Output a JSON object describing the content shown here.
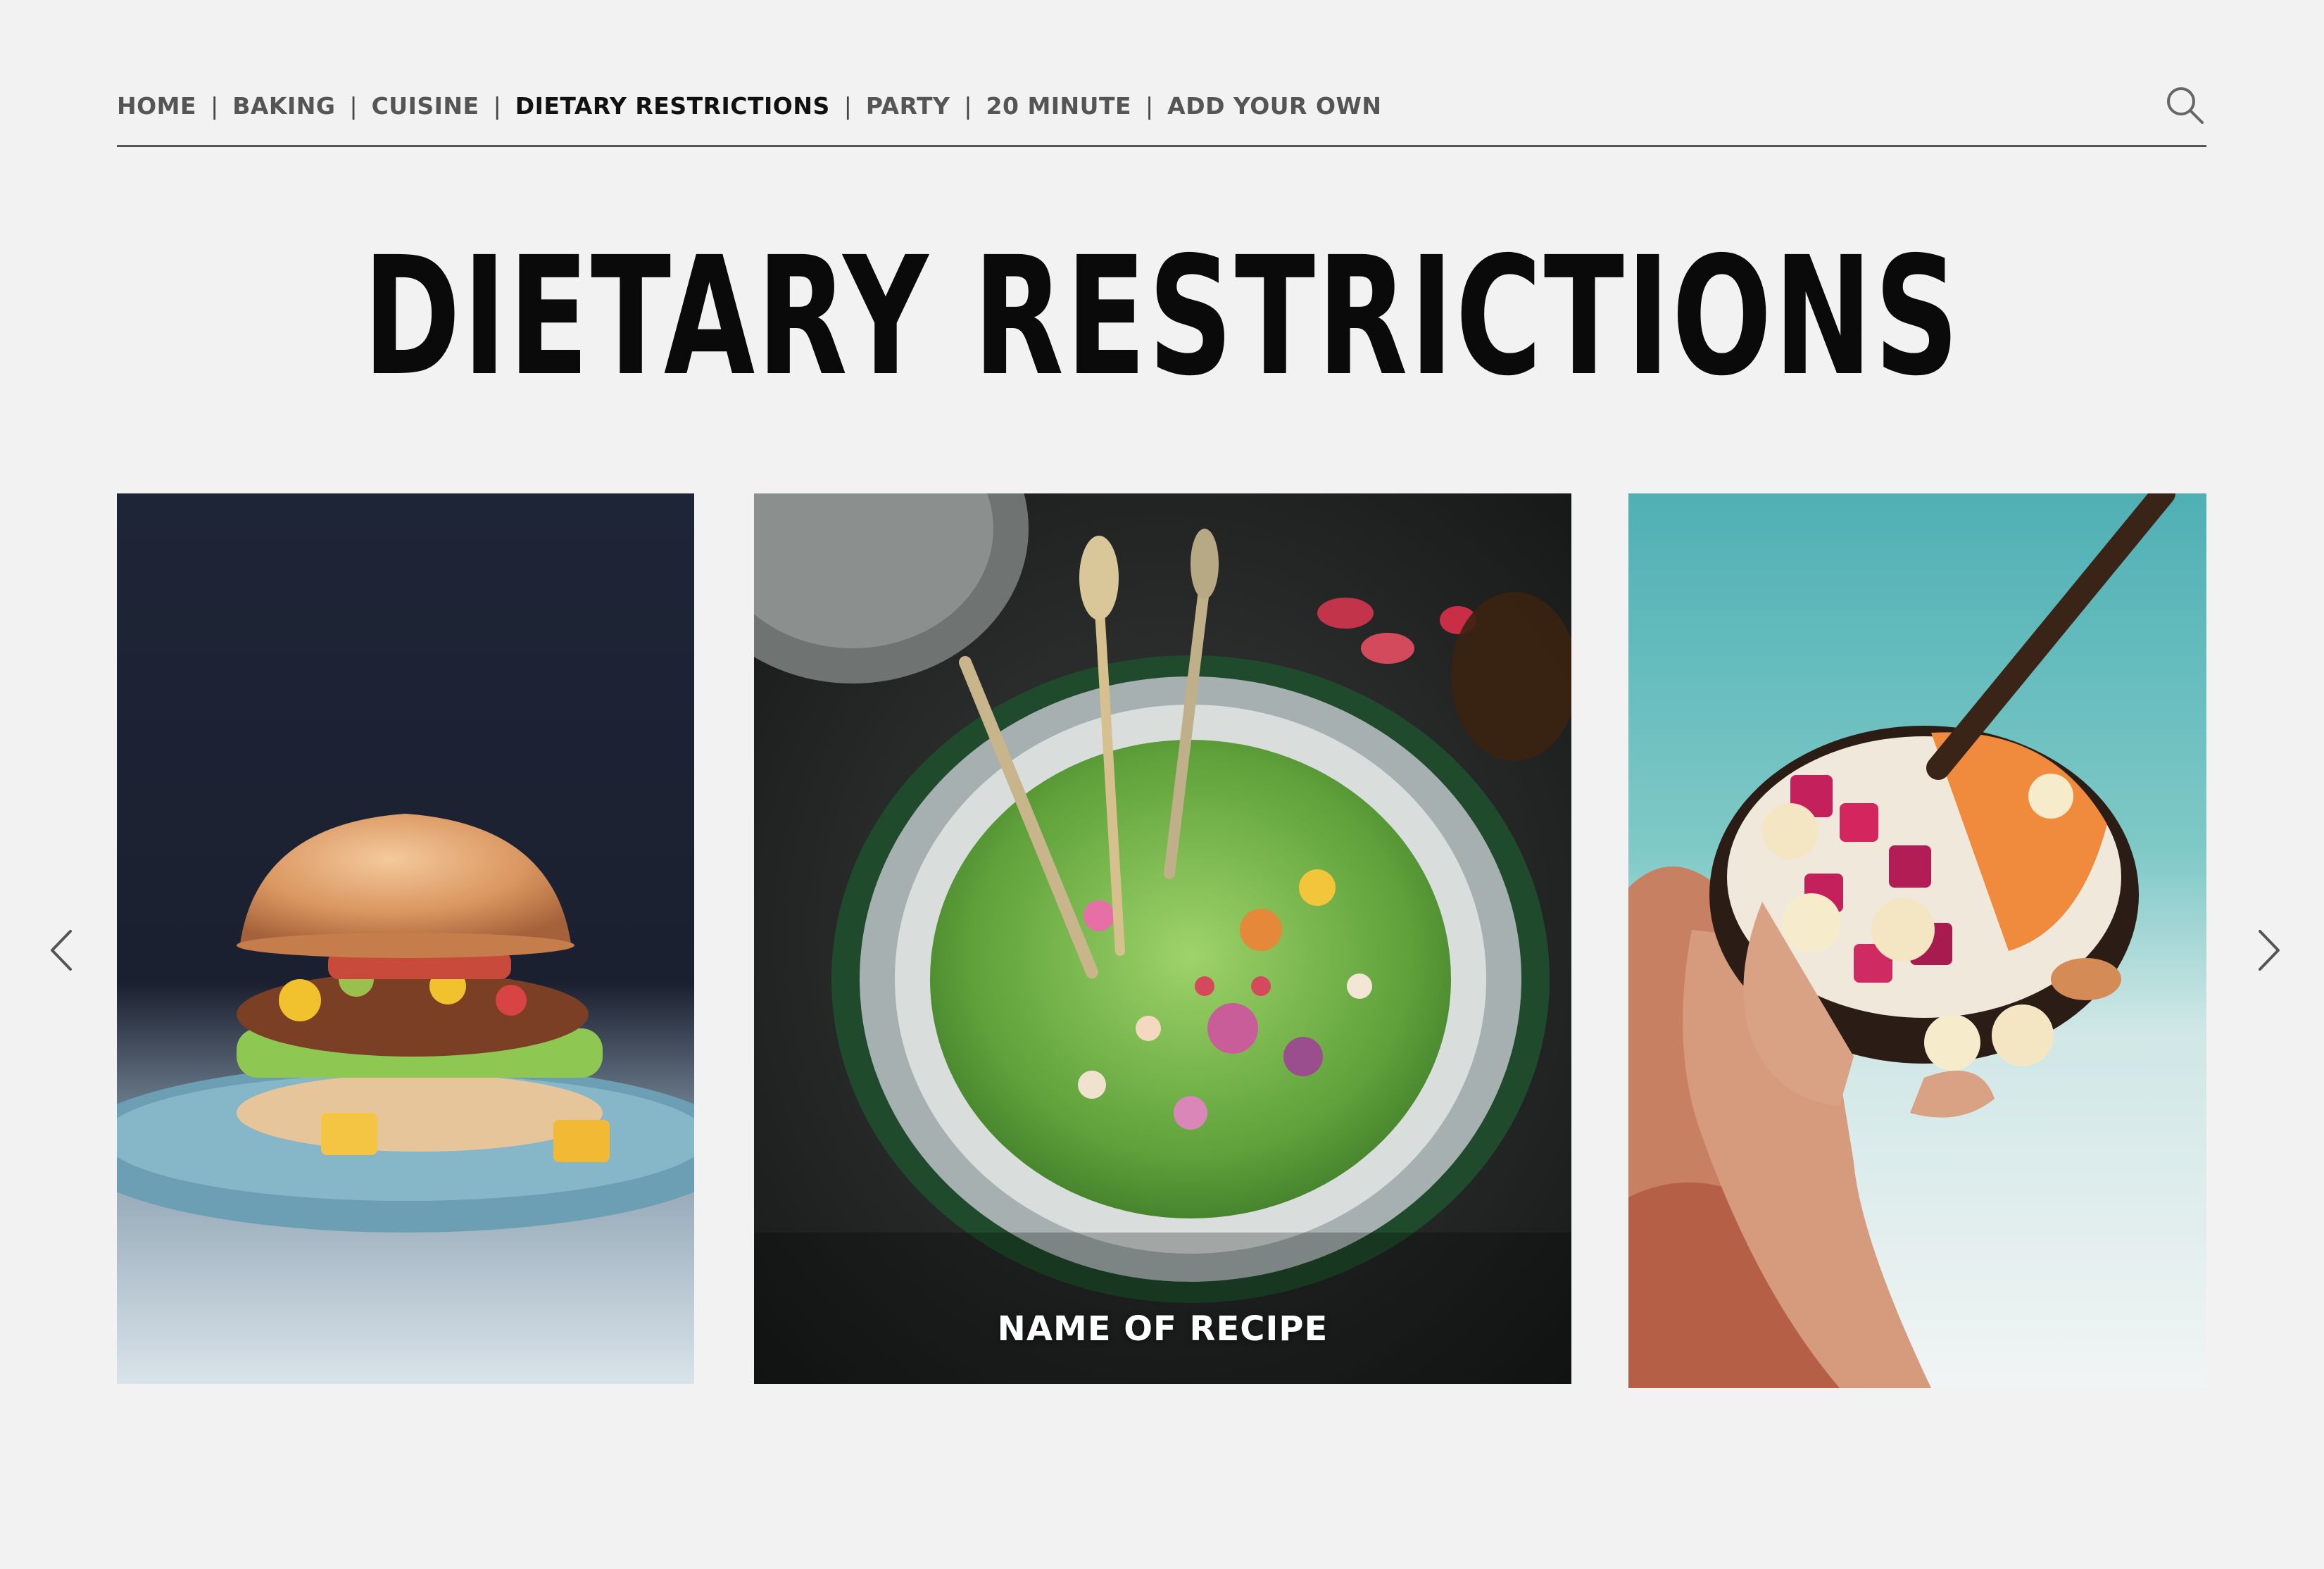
{
  "nav": {
    "items": [
      {
        "label": "HOME",
        "active": false
      },
      {
        "label": "BAKING",
        "active": false
      },
      {
        "label": "CUISINE",
        "active": false
      },
      {
        "label": "DIETARY RESTRICTIONS",
        "active": true
      },
      {
        "label": "PARTY",
        "active": false
      },
      {
        "label": "20 MINUTE",
        "active": false
      },
      {
        "label": "ADD YOUR OWN",
        "active": false
      }
    ],
    "separator": "|"
  },
  "page": {
    "title": "DIETARY RESTRICTIONS"
  },
  "carousel": {
    "cards": [
      {
        "image": "veggie-burger-photo"
      },
      {
        "image": "green-salad-bowl-photo",
        "caption": "NAME OF RECIPE"
      },
      {
        "image": "smoothie-bowl-photo"
      }
    ]
  },
  "icons": {
    "search": "search-icon",
    "prev": "chevron-left-icon",
    "next": "chevron-right-icon"
  },
  "colors": {
    "background": "#f2f2f2",
    "text": "#0a0a0a",
    "nav_text": "#555555"
  }
}
